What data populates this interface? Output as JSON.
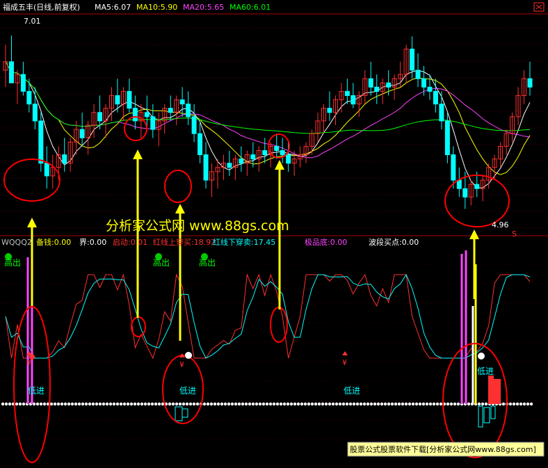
{
  "upper": {
    "title": "福成五丰(日线,前复权)",
    "ma_labels": [
      {
        "text": "MA5:6.07",
        "color": "#ffffff"
      },
      {
        "text": "MA10:5.90",
        "color": "#ffff00"
      },
      {
        "text": "MA20:5.65",
        "color": "#ff44ff"
      },
      {
        "text": "MA60:6.01",
        "color": "#00ff00"
      }
    ],
    "high_label": "7.01",
    "low_label": "4.96",
    "s_marker": "S"
  },
  "lower": {
    "labels": [
      {
        "text": "WQQQ2",
        "color": "#c0c0c0"
      },
      {
        "text": "备钱:0.00",
        "color": "#ffff00"
      },
      {
        "text": "界:0.00",
        "color": "#ffffff"
      },
      {
        "text": "启动:0.01",
        "color": "#ff3030"
      },
      {
        "text": "红线上穿买:18.92",
        "color": "#ff3030"
      },
      {
        "text": "红线下穿卖:17.45",
        "color": "#00ffff"
      },
      {
        "text": "极品底:0.00",
        "color": "#ff44ff"
      },
      {
        "text": "波段买点:0.00",
        "color": "#ffffff"
      }
    ],
    "signal_sell": "高出",
    "signal_buy": "低进",
    "yen_mark": "¥"
  },
  "watermark_center": "分析家公式网 www.88gs.com",
  "watermark_footer": "股票公式股票软件下载[分析家公式网www.88gs.com]",
  "colors": {
    "bull": "#ff3030",
    "bear": "#00ffff",
    "ma5": "#ffffff",
    "ma10": "#ffff00",
    "ma20": "#ff44ff",
    "ma60": "#00ff00",
    "annotation": "#ff0000",
    "arrow": "#ffff00"
  },
  "chart_data": [
    {
      "type": "candlestick",
      "title": "福成五丰(日线,前复权)",
      "series": [
        {
          "name": "MA5",
          "last": 6.07
        },
        {
          "name": "MA10",
          "last": 5.9
        },
        {
          "name": "MA20",
          "last": 5.65
        },
        {
          "name": "MA60",
          "last": 6.01
        }
      ],
      "annotations": [
        "7.01",
        "4.96"
      ],
      "ohlc": [
        [
          6.6,
          6.9,
          6.4,
          6.7
        ],
        [
          6.7,
          7.01,
          6.5,
          6.45
        ],
        [
          6.45,
          6.6,
          6.2,
          6.55
        ],
        [
          6.55,
          6.7,
          6.3,
          6.35
        ],
        [
          6.35,
          6.5,
          6.1,
          6.2
        ],
        [
          6.2,
          6.4,
          5.9,
          6.0
        ],
        [
          6.0,
          6.1,
          5.4,
          5.5
        ],
        [
          5.5,
          5.7,
          5.2,
          5.35
        ],
        [
          5.35,
          5.6,
          5.2,
          5.45
        ],
        [
          5.45,
          5.7,
          5.3,
          5.6
        ],
        [
          5.6,
          5.8,
          5.4,
          5.5
        ],
        [
          5.5,
          5.8,
          5.4,
          5.75
        ],
        [
          5.75,
          6.0,
          5.6,
          5.9
        ],
        [
          5.9,
          6.1,
          5.7,
          5.8
        ],
        [
          5.8,
          6.0,
          5.6,
          5.95
        ],
        [
          5.95,
          6.2,
          5.8,
          6.1
        ],
        [
          6.1,
          6.3,
          5.9,
          6.0
        ],
        [
          6.0,
          6.2,
          5.8,
          6.15
        ],
        [
          6.15,
          6.4,
          6.0,
          6.3
        ],
        [
          6.3,
          6.5,
          6.1,
          6.2
        ],
        [
          6.2,
          6.4,
          6.0,
          6.35
        ],
        [
          6.35,
          6.5,
          6.1,
          6.15
        ],
        [
          6.15,
          6.3,
          5.9,
          6.0
        ],
        [
          6.0,
          6.2,
          5.8,
          6.1
        ],
        [
          6.1,
          6.3,
          5.9,
          6.05
        ],
        [
          6.05,
          6.2,
          5.8,
          5.9
        ],
        [
          5.9,
          6.1,
          5.7,
          6.0
        ],
        [
          6.0,
          6.2,
          5.85,
          6.15
        ],
        [
          6.15,
          6.3,
          6.0,
          6.1
        ],
        [
          6.1,
          6.3,
          5.95,
          6.25
        ],
        [
          6.25,
          6.4,
          6.05,
          6.2
        ],
        [
          6.2,
          6.35,
          5.95,
          6.05
        ],
        [
          6.05,
          6.2,
          5.75,
          5.85
        ],
        [
          5.85,
          6.0,
          5.5,
          5.6
        ],
        [
          5.6,
          5.75,
          5.2,
          5.3
        ],
        [
          5.3,
          5.5,
          5.1,
          5.4
        ],
        [
          5.4,
          5.55,
          5.2,
          5.45
        ],
        [
          5.45,
          5.6,
          5.3,
          5.5
        ],
        [
          5.5,
          5.65,
          5.35,
          5.45
        ],
        [
          5.45,
          5.6,
          5.3,
          5.55
        ],
        [
          5.55,
          5.7,
          5.4,
          5.5
        ],
        [
          5.5,
          5.65,
          5.35,
          5.6
        ],
        [
          5.6,
          5.75,
          5.45,
          5.55
        ],
        [
          5.55,
          5.7,
          5.4,
          5.65
        ],
        [
          5.65,
          5.8,
          5.5,
          5.6
        ],
        [
          5.6,
          5.75,
          5.45,
          5.7
        ],
        [
          5.7,
          5.85,
          5.55,
          5.65
        ],
        [
          5.65,
          5.8,
          5.5,
          5.6
        ],
        [
          5.6,
          5.75,
          5.4,
          5.5
        ],
        [
          5.5,
          5.65,
          5.35,
          5.55
        ],
        [
          5.55,
          5.7,
          5.45,
          5.6
        ],
        [
          5.6,
          5.75,
          5.5,
          5.7
        ],
        [
          5.7,
          5.9,
          5.6,
          5.85
        ],
        [
          5.85,
          6.1,
          5.75,
          6.0
        ],
        [
          6.0,
          6.2,
          5.85,
          6.15
        ],
        [
          6.15,
          6.35,
          6.0,
          6.1
        ],
        [
          6.1,
          6.3,
          5.95,
          6.25
        ],
        [
          6.25,
          6.45,
          6.1,
          6.35
        ],
        [
          6.35,
          6.5,
          6.2,
          6.3
        ],
        [
          6.3,
          6.45,
          6.15,
          6.2
        ],
        [
          6.2,
          6.35,
          6.05,
          6.3
        ],
        [
          6.3,
          6.6,
          6.2,
          6.5
        ],
        [
          6.5,
          6.7,
          6.3,
          6.4
        ],
        [
          6.4,
          6.55,
          6.2,
          6.35
        ],
        [
          6.35,
          6.5,
          6.2,
          6.45
        ],
        [
          6.45,
          6.6,
          6.3,
          6.4
        ],
        [
          6.4,
          6.55,
          6.25,
          6.5
        ],
        [
          6.5,
          6.7,
          6.4,
          6.55
        ],
        [
          6.55,
          6.9,
          6.45,
          6.85
        ],
        [
          6.85,
          7.0,
          6.5,
          6.6
        ],
        [
          6.6,
          6.8,
          6.4,
          6.5
        ],
        [
          6.5,
          6.65,
          6.3,
          6.4
        ],
        [
          6.4,
          6.55,
          6.25,
          6.35
        ],
        [
          6.35,
          6.5,
          6.1,
          6.2
        ],
        [
          6.2,
          6.35,
          5.9,
          6.0
        ],
        [
          6.0,
          6.1,
          5.5,
          5.6
        ],
        [
          5.6,
          5.7,
          5.2,
          5.3
        ],
        [
          5.3,
          5.45,
          5.1,
          5.2
        ],
        [
          5.2,
          5.4,
          4.96,
          5.1
        ],
        [
          5.1,
          5.3,
          5.0,
          5.25
        ],
        [
          5.25,
          5.4,
          5.1,
          5.2
        ],
        [
          5.2,
          5.35,
          5.05,
          5.3
        ],
        [
          5.3,
          5.5,
          5.2,
          5.45
        ],
        [
          5.45,
          5.6,
          5.3,
          5.55
        ],
        [
          5.55,
          5.75,
          5.45,
          5.7
        ],
        [
          5.7,
          5.9,
          5.6,
          5.85
        ],
        [
          5.85,
          6.1,
          5.75,
          6.05
        ],
        [
          6.05,
          6.4,
          5.95,
          6.3
        ],
        [
          6.3,
          6.6,
          6.2,
          6.5
        ],
        [
          6.5,
          6.7,
          6.3,
          6.4
        ]
      ]
    },
    {
      "type": "line",
      "series": [
        {
          "name": "红线上穿买",
          "last": 18.92
        },
        {
          "name": "红线下穿卖",
          "last": 17.45
        }
      ],
      "ylim": [
        0,
        100
      ]
    }
  ]
}
